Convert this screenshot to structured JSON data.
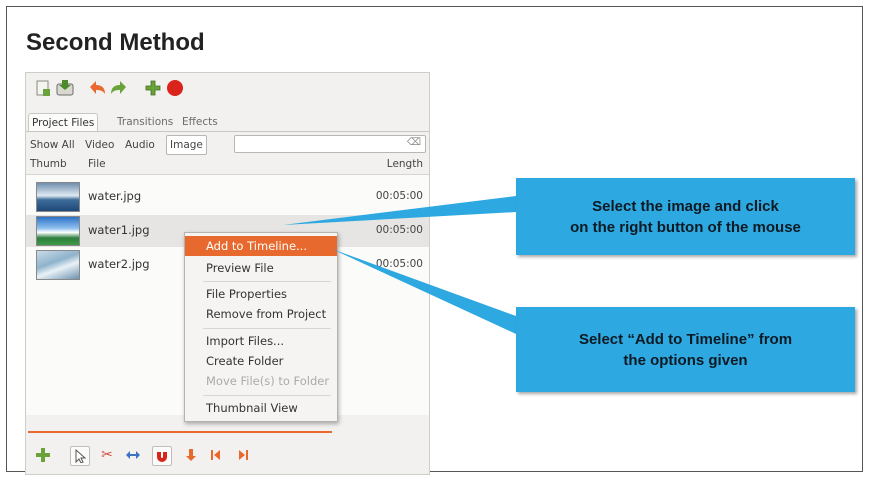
{
  "heading": "Second Method",
  "tabs": [
    "Project Files",
    "Transitions",
    "Effects"
  ],
  "filters": [
    "Show All",
    "Video",
    "Audio",
    "Image"
  ],
  "search": {
    "placeholder": ""
  },
  "columns": {
    "thumb": "Thumb",
    "file": "File",
    "length": "Length"
  },
  "files": [
    {
      "name": "water.jpg",
      "length": "00:05:00"
    },
    {
      "name": "water1.jpg",
      "length": "00:05:00"
    },
    {
      "name": "water2.jpg",
      "length": "00:05:00"
    }
  ],
  "context_menu": {
    "items": [
      {
        "label": "Add to Timeline...",
        "state": "active"
      },
      {
        "label": "Preview File",
        "state": "normal"
      },
      {
        "label": "File Properties",
        "state": "normal"
      },
      {
        "label": "Remove from Project",
        "state": "normal"
      },
      {
        "label": "Import Files...",
        "state": "normal"
      },
      {
        "label": "Create Folder",
        "state": "normal"
      },
      {
        "label": "Move File(s) to Folder",
        "state": "disabled"
      },
      {
        "label": "Thumbnail View",
        "state": "normal"
      }
    ]
  },
  "callouts": {
    "select_image": [
      "Select the image and click",
      "on the right button of the mouse"
    ],
    "add_timeline": [
      "Select “Add to Timeline” from",
      "the options given"
    ]
  },
  "colors": {
    "accent": "#e8692e",
    "callout": "#2ea8e0"
  },
  "icons": {
    "top_toolbar": [
      "new-project-icon",
      "save-project-icon",
      "undo-icon",
      "redo-icon",
      "add-files-icon",
      "record-icon"
    ],
    "bottom_toolbar": [
      "add-track-icon",
      "select-pointer-icon",
      "razor-icon",
      "resize-icon",
      "snap-magnet-icon",
      "add-marker-icon",
      "previous-marker-icon",
      "next-marker-icon"
    ]
  }
}
